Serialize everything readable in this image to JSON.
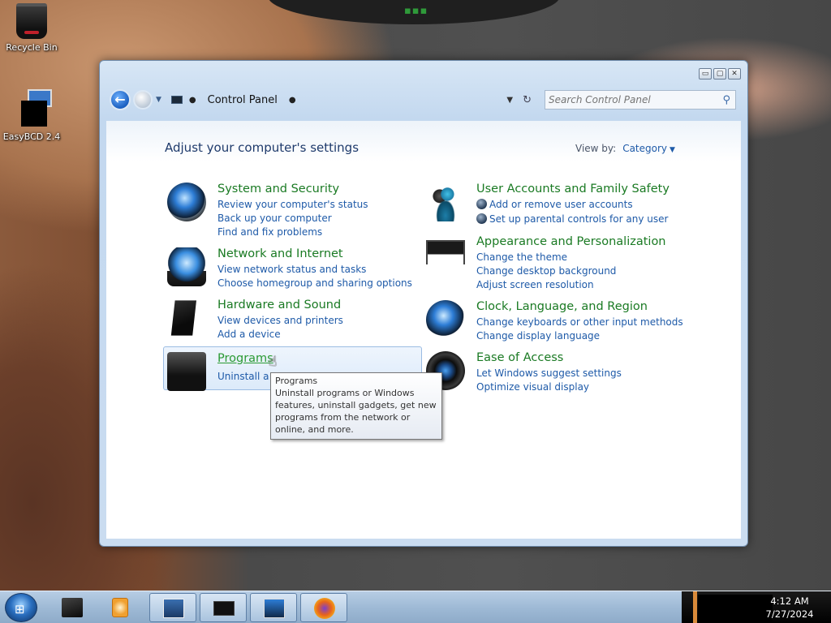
{
  "desktop": {
    "icons": [
      {
        "label": "Recycle Bin"
      },
      {
        "label": "EasyBCD 2.4"
      }
    ]
  },
  "window": {
    "controls": {
      "minimize": "▭",
      "maximize": "▢",
      "close": "✕"
    },
    "address": {
      "location": "Control Panel"
    },
    "search": {
      "placeholder": "Search Control Panel"
    },
    "heading": "Adjust your computer's settings",
    "view_by": {
      "label": "View by:",
      "value": "Category"
    },
    "categories": [
      {
        "title": "System and Security",
        "links": [
          "Review your computer's status",
          "Back up your computer",
          "Find and fix problems"
        ]
      },
      {
        "title": "Network and Internet",
        "links": [
          "View network status and tasks",
          "Choose homegroup and sharing options"
        ]
      },
      {
        "title": "Hardware and Sound",
        "links": [
          "View devices and printers",
          "Add a device"
        ]
      },
      {
        "title": "Programs",
        "links": [
          "Uninstall a pr"
        ]
      },
      {
        "title": "User Accounts and Family Safety",
        "links": [
          "Add or remove user accounts",
          "Set up parental controls for any user"
        ]
      },
      {
        "title": "Appearance and Personalization",
        "links": [
          "Change the theme",
          "Change desktop background",
          "Adjust screen resolution"
        ]
      },
      {
        "title": "Clock, Language, and Region",
        "links": [
          "Change keyboards or other input methods",
          "Change display language"
        ]
      },
      {
        "title": "Ease of Access",
        "links": [
          "Let Windows suggest settings",
          "Optimize visual display"
        ]
      }
    ],
    "tooltip": {
      "title": "Programs",
      "body": "Uninstall programs or Windows features, uninstall gadgets, get new programs from the network or online, and more."
    }
  },
  "taskbar": {
    "clock": {
      "time": "4:12 AM",
      "date": "7/27/2024"
    }
  },
  "colors": {
    "category_title": "#1a7a23",
    "link": "#1e5aa8",
    "heading": "#1e3a6b"
  }
}
